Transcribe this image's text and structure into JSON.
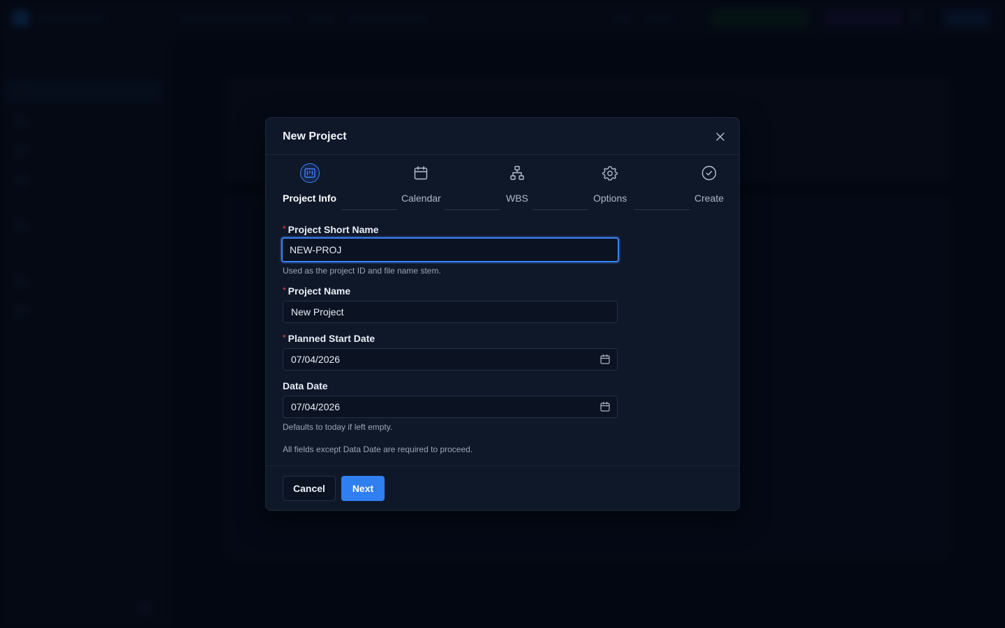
{
  "modal": {
    "title": "New Project",
    "steps": [
      {
        "label": "Project Info",
        "icon": "project-info-icon",
        "active": true
      },
      {
        "label": "Calendar",
        "icon": "calendar-icon",
        "active": false
      },
      {
        "label": "WBS",
        "icon": "wbs-icon",
        "active": false
      },
      {
        "label": "Options",
        "icon": "gear-icon",
        "active": false
      },
      {
        "label": "Create",
        "icon": "check-circle-icon",
        "active": false
      }
    ],
    "fields": {
      "short_name": {
        "label": "Project Short Name",
        "value": "NEW-PROJ",
        "required": true,
        "help": "Used as the project ID and file name stem."
      },
      "name": {
        "label": "Project Name",
        "value": "New Project",
        "required": true
      },
      "start_date": {
        "label": "Planned Start Date",
        "value": "07/04/2026",
        "required": true
      },
      "data_date": {
        "label": "Data Date",
        "value": "07/04/2026",
        "required": false,
        "help": "Defaults to today if left empty."
      }
    },
    "note": "All fields except Data Date are required to proceed.",
    "buttons": {
      "cancel": "Cancel",
      "next": "Next"
    },
    "required_marker": "*"
  },
  "colors": {
    "accent": "#2f7ff0",
    "required": "#ef4444",
    "modal_bg": "#0f1829",
    "page_bg": "#060b16"
  }
}
